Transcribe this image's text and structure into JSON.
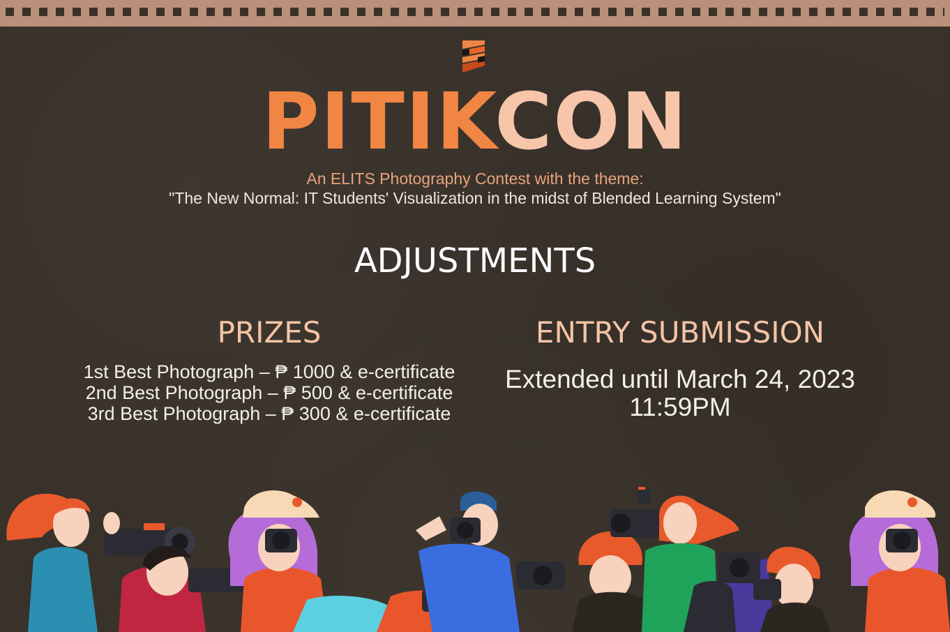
{
  "title": {
    "part1": "PITIK",
    "part2": "CON"
  },
  "subtitle": {
    "line1": "An ELITS Photography Contest with the theme:",
    "line2": "\"The New Normal: IT Students' Visualization in the midst of Blended Learning System\""
  },
  "heading": "ADJUSTMENTS",
  "prizes": {
    "heading": "PRIZES",
    "items": [
      "1st Best Photograph – ₱ 1000 & e-certificate",
      "2nd Best Photograph – ₱ 500 & e-certificate",
      "3rd Best Photograph – ₱ 300 & e-certificate"
    ]
  },
  "entry": {
    "heading": "ENTRY SUBMISSION",
    "line1": "Extended until March 24, 2023",
    "line2": "11:59PM"
  },
  "colors": {
    "background": "#39322b",
    "film_strip": "#b9907a",
    "accent_orange": "#f08544",
    "accent_peach": "#f6c5aa",
    "text_light": "#f4efe9"
  },
  "icons": [
    "logo-mark-icon",
    "film-strip",
    "photographers-illustration"
  ]
}
